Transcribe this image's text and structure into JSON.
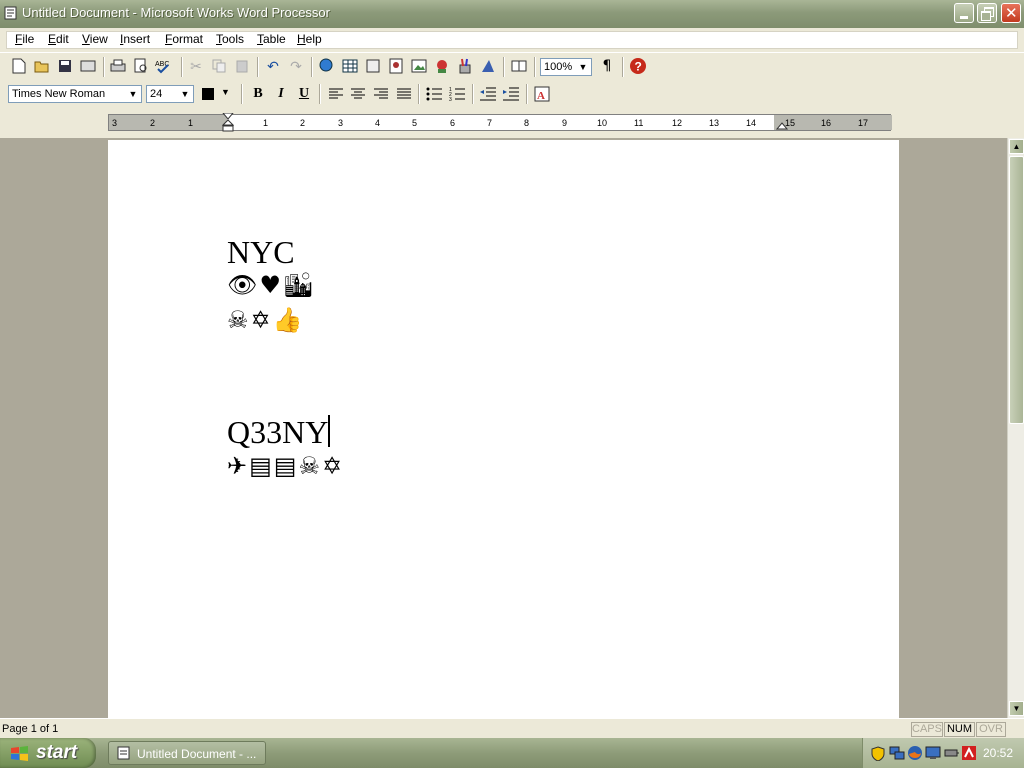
{
  "window": {
    "title": "Untitled Document - Microsoft Works Word Processor"
  },
  "menu": [
    {
      "key": "F",
      "rest": "ile"
    },
    {
      "key": "E",
      "rest": "dit"
    },
    {
      "key": "V",
      "rest": "iew"
    },
    {
      "key": "I",
      "rest": "nsert"
    },
    {
      "key": "F",
      "rest": "ormat",
      "pre": ""
    },
    {
      "key": "T",
      "rest": "ools"
    },
    {
      "key": "T",
      "rest": "able"
    },
    {
      "key": "H",
      "rest": "elp"
    }
  ],
  "toolbar": {
    "zoom": "100%",
    "font_name": "Times New Roman",
    "font_size": "24",
    "bold": "B",
    "italic": "I",
    "underline": "U",
    "pilcrow": "¶"
  },
  "ruler": {
    "labels": [
      "3",
      "2",
      "1",
      "1",
      "2",
      "3",
      "4",
      "5",
      "6",
      "7",
      "8",
      "9",
      "10",
      "11",
      "12",
      "13",
      "14",
      "15",
      "16",
      "17"
    ]
  },
  "document": {
    "line1": "NYC",
    "line2_symbols": "👁♥🏙",
    "line3_symbols": "☠✡👍",
    "line4": "Q33NY",
    "line5_symbols": "✈▤▤☠✡"
  },
  "status": {
    "page": "Page 1 of 1",
    "caps": "CAPS",
    "num": "NUM",
    "ovr": "OVR"
  },
  "taskbar": {
    "start": "start",
    "task_label": "Untitled Document - ...",
    "clock": "20:52"
  },
  "colors": {
    "title_bar": "#8c9a7a",
    "close_button": "#c23a1f",
    "workspace": "#aca899"
  }
}
